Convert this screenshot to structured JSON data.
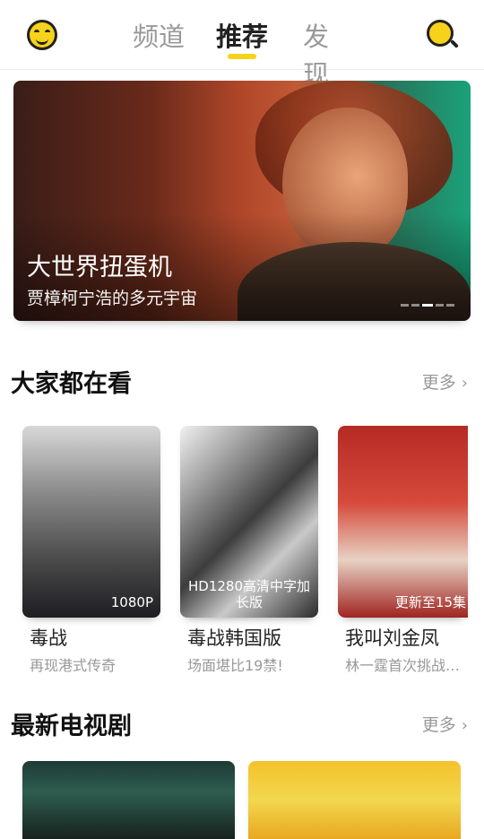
{
  "header": {
    "tabs": [
      "频道",
      "推荐",
      "发现"
    ],
    "active_tab": "推荐"
  },
  "banner": {
    "title": "大世界扭蛋机",
    "subtitle": "贾樟柯宁浩的多元宇宙",
    "dots": 5,
    "active_dot": 3
  },
  "section_popular": {
    "title": "大家都在看",
    "more": "更多",
    "items": [
      {
        "title": "毒战",
        "subtitle": "再现港式传奇",
        "badge": "1080P"
      },
      {
        "title": "毒战韩国版",
        "subtitle": "场面堪比19禁!",
        "badge": "HD1280高清中字加长版"
      },
      {
        "title": "我叫刘金凤",
        "subtitle": "林一霆首次挑战…",
        "badge": "更新至15集"
      }
    ]
  },
  "section_tv": {
    "title": "最新电视剧",
    "more": "更多"
  },
  "colors": {
    "accent": "#f7d21b",
    "text": "#222222",
    "muted": "#999999"
  }
}
